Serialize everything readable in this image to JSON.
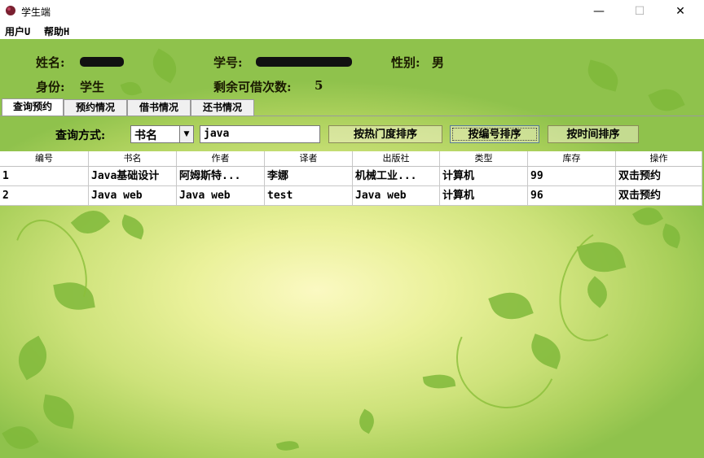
{
  "window": {
    "title": "学生端",
    "minimize": "—",
    "maximize": "☐",
    "close": "✕"
  },
  "menu": [
    {
      "label": "用户U"
    },
    {
      "label": "帮助H"
    }
  ],
  "info": {
    "name_label": "姓名:",
    "id_label": "学号:",
    "gender_label": "性别:",
    "gender_value": "男",
    "role_label": "身份:",
    "role_value": "学生",
    "remaining_label": "剩余可借次数:",
    "remaining_value": "5"
  },
  "tabs": [
    {
      "label": "查询预约",
      "active": true
    },
    {
      "label": "预约情况"
    },
    {
      "label": "借书情况"
    },
    {
      "label": "还书情况"
    }
  ],
  "query": {
    "label": "查询方式:",
    "mode": "书名",
    "input": "java",
    "sort_hot": "按热门度排序",
    "sort_id": "按编号排序",
    "sort_time": "按时间排序"
  },
  "table": {
    "headers": [
      "编号",
      "书名",
      "作者",
      "译者",
      "出版社",
      "类型",
      "库存",
      "操作"
    ],
    "rows": [
      [
        "1",
        "Java基础设计",
        "阿姆斯特...",
        "李娜",
        "机械工业...",
        "计算机",
        "99",
        "双击预约"
      ],
      [
        "2",
        "Java web",
        "Java web",
        "test",
        "Java web",
        "计算机",
        "96",
        "双击预约"
      ]
    ]
  }
}
